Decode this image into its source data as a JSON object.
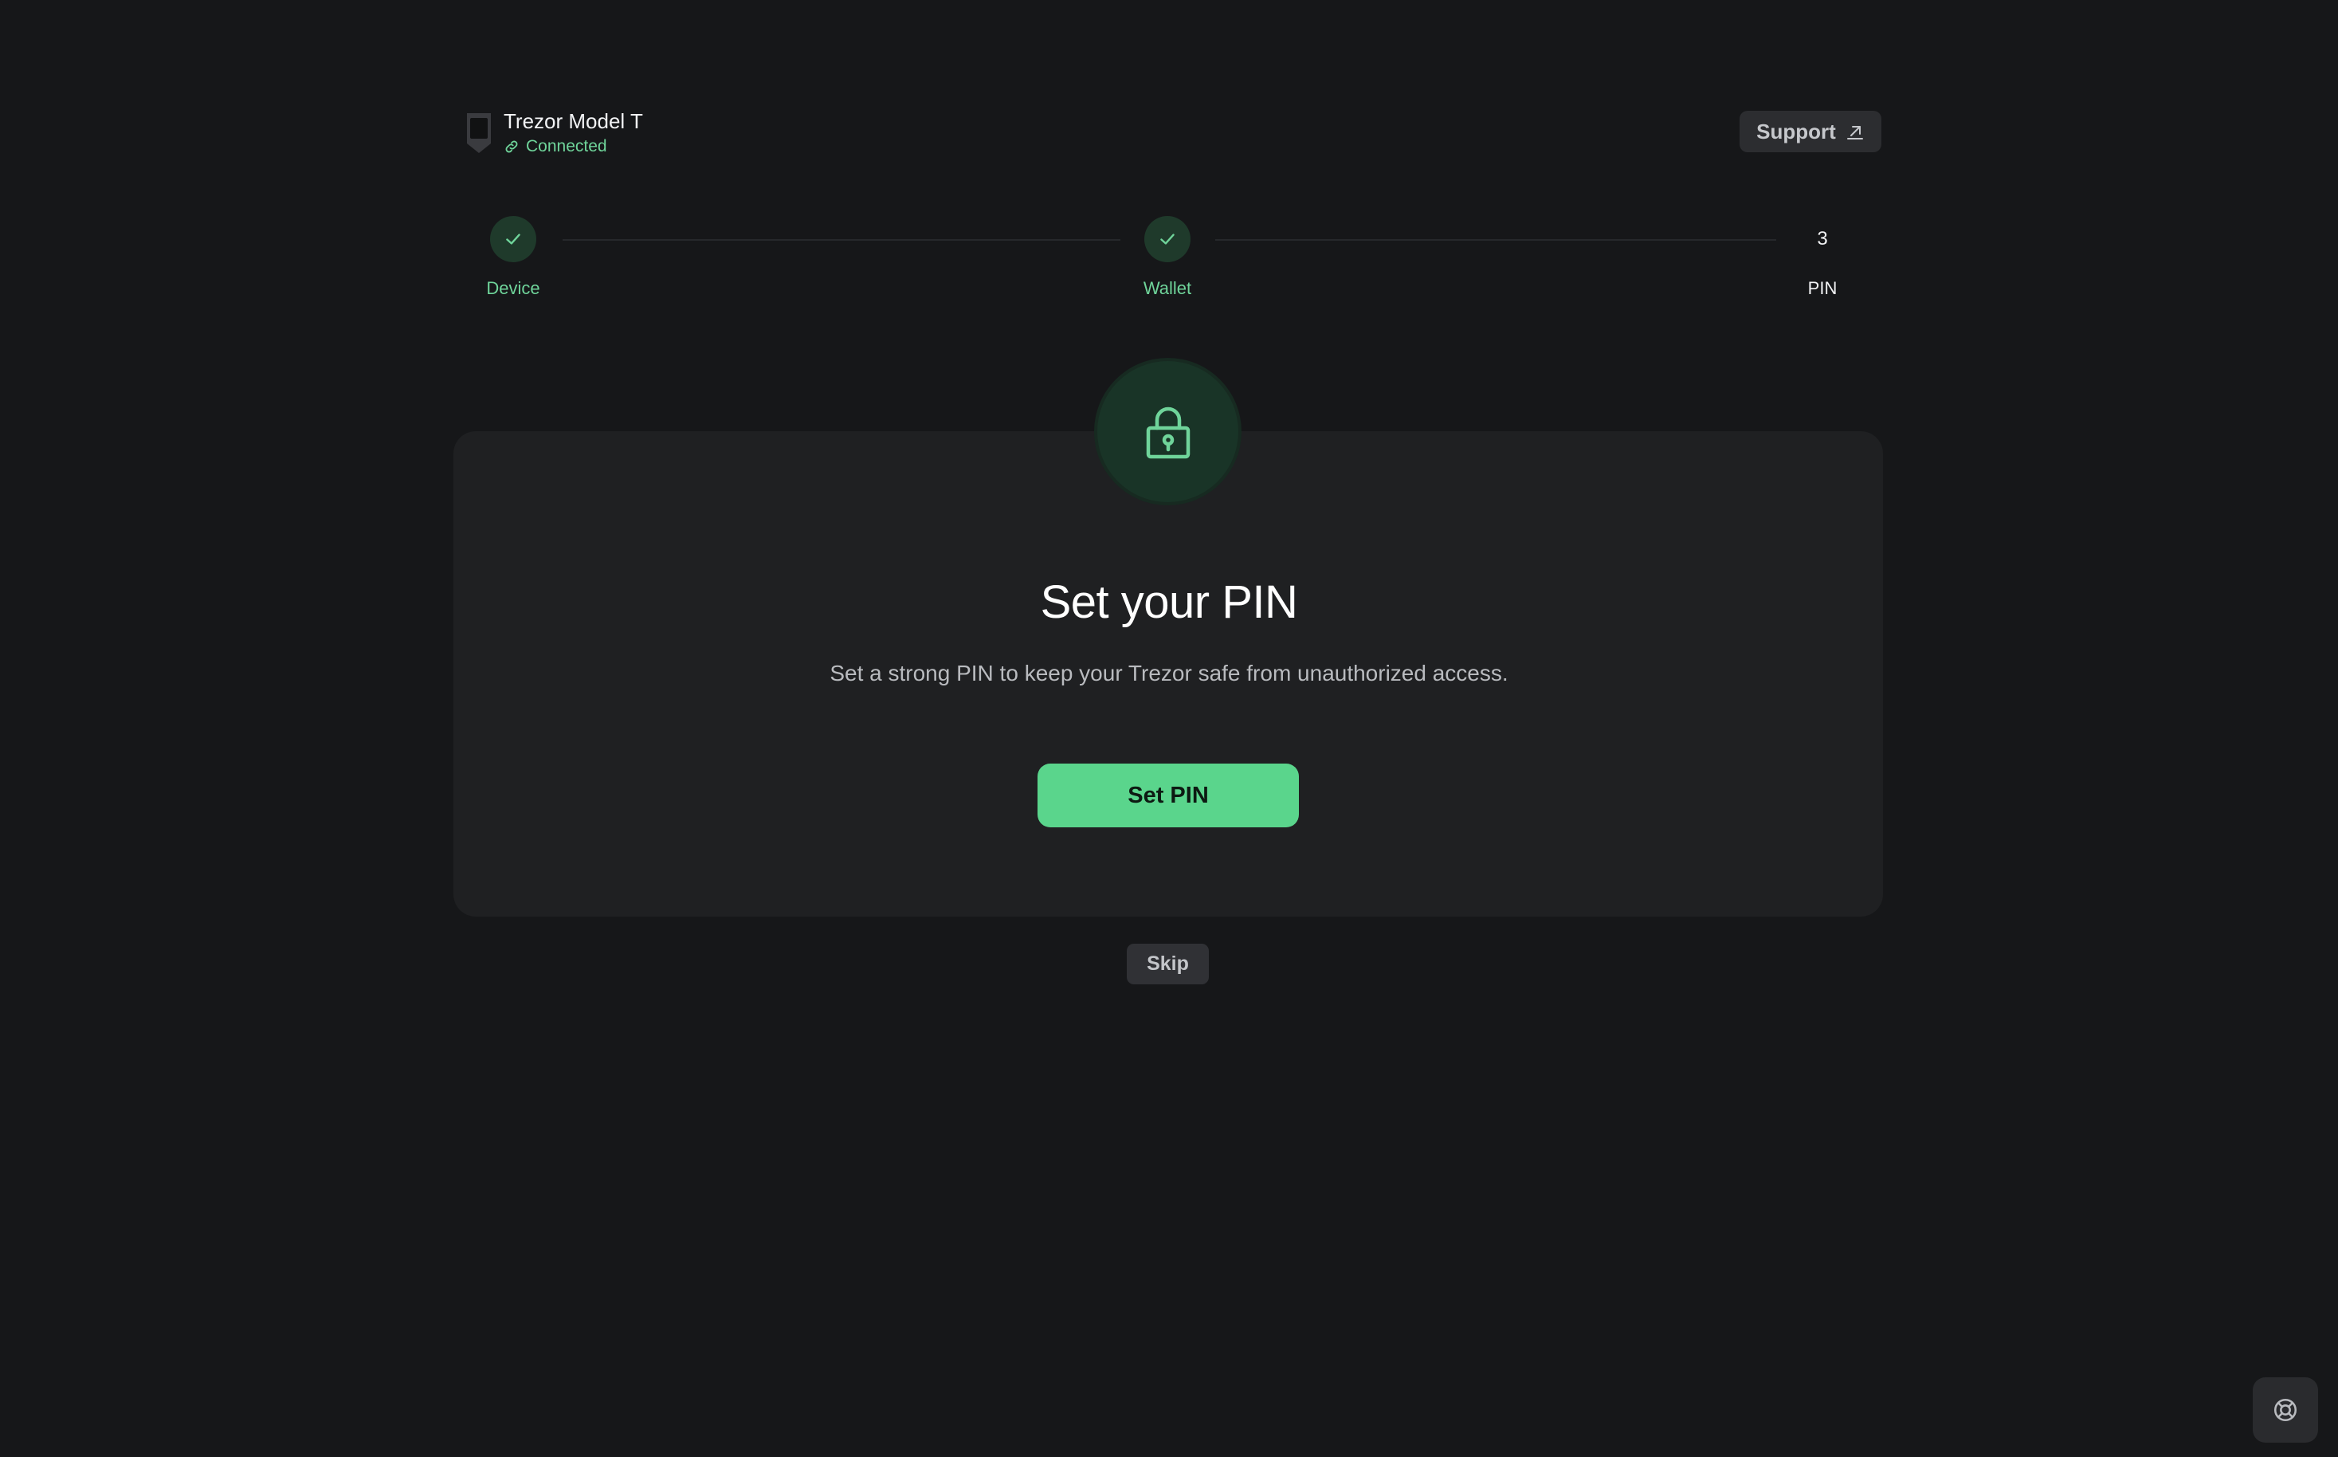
{
  "device": {
    "name": "Trezor Model T",
    "status": "Connected"
  },
  "header": {
    "support_label": "Support"
  },
  "stepper": {
    "steps": [
      {
        "label": "Device",
        "state": "done"
      },
      {
        "label": "Wallet",
        "state": "done"
      },
      {
        "label": "PIN",
        "number": "3",
        "state": "current"
      }
    ]
  },
  "card": {
    "title": "Set your PIN",
    "subtitle": "Set a strong PIN to keep your Trezor safe from unauthorized access.",
    "primary_label": "Set PIN"
  },
  "footer": {
    "skip_label": "Skip"
  },
  "colors": {
    "background": "#161719",
    "card": "#1f2022",
    "accent": "#5ad58c",
    "accent_text": "#6fd49a"
  },
  "icons": {
    "device": "trezor-device-icon",
    "status": "link-icon",
    "support": "external-link-icon",
    "step_done": "check-icon",
    "lock": "lock-icon",
    "help": "lifebuoy-icon"
  }
}
